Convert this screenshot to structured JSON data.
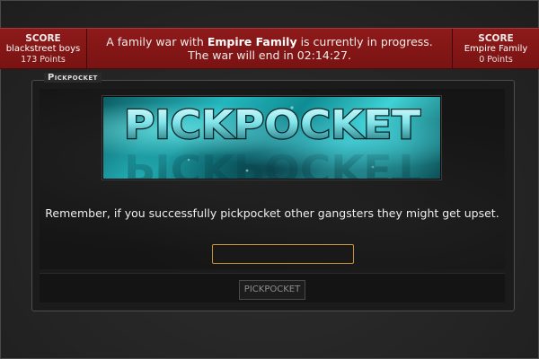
{
  "war_banner": {
    "left_team": {
      "score_label": "SCORE",
      "name": "blackstreet boys",
      "points": "173 Points"
    },
    "right_team": {
      "score_label": "SCORE",
      "name": "Empire Family",
      "points": "0 Points"
    },
    "message": {
      "prefix": "A family war with ",
      "family": "Empire Family",
      "suffix": " is currently in progress.",
      "line2_prefix": "The war will end in ",
      "countdown": "02:14:27",
      "line2_suffix": "."
    },
    "colors": {
      "background": "#841616",
      "text": "#f4eaea"
    }
  },
  "panel": {
    "legend": "Pickpocket",
    "banner_title": "PICKPOCKET",
    "notice": "Remember, if you successfully pickpocket other gangsters they might get upset.",
    "target_input": {
      "value": "",
      "placeholder": ""
    },
    "submit_label": "PICKPOCKET",
    "colors": {
      "banner_teal": "#24b6bd",
      "input_border": "#c99230"
    }
  }
}
